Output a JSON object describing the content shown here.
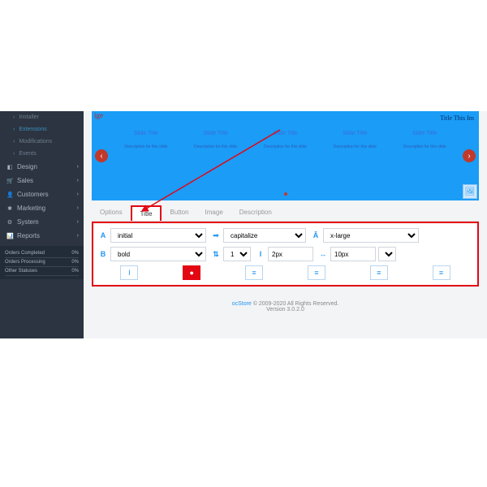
{
  "sidebar": {
    "sub": [
      {
        "label": "Installer",
        "active": false
      },
      {
        "label": "Extensions",
        "active": true
      },
      {
        "label": "Modifications",
        "active": false
      },
      {
        "label": "Events",
        "active": false
      }
    ],
    "items": [
      {
        "label": "Design",
        "icon": "◧"
      },
      {
        "label": "Sales",
        "icon": "🛒"
      },
      {
        "label": "Customers",
        "icon": "👤"
      },
      {
        "label": "Marketing",
        "icon": "✱"
      },
      {
        "label": "System",
        "icon": "⚙"
      },
      {
        "label": "Reports",
        "icon": "📊"
      }
    ],
    "stats": [
      {
        "label": "Orders Completed",
        "value": "0%"
      },
      {
        "label": "Orders Processing",
        "value": "0%"
      },
      {
        "label": "Other Statuses",
        "value": "0%"
      }
    ]
  },
  "banner": {
    "corner": "ige",
    "right": "Title This Im",
    "slides": [
      {
        "title": "Slide Title",
        "desc": "Description for this slide"
      },
      {
        "title": "Slide Title",
        "desc": "Description for this slide"
      },
      {
        "title": "Slide Title",
        "desc": "Description for this slide"
      },
      {
        "title": "Slide Title",
        "desc": "Description for this slide"
      },
      {
        "title": "Slide Title",
        "desc": "Description for this slide"
      }
    ]
  },
  "tabs": [
    {
      "label": "Options"
    },
    {
      "label": "Title"
    },
    {
      "label": "Button"
    },
    {
      "label": "Image"
    },
    {
      "label": "Description"
    }
  ],
  "active_tab": 1,
  "fields": {
    "font_family": "initial",
    "text_transform": "capitalize",
    "font_size": "x-large",
    "font_weight": "bold",
    "line_height_mode": "1",
    "line_height_val": "2px",
    "letter_spacing": "10px"
  },
  "buttons_row": [
    "I",
    "●",
    "≡",
    "≡",
    "≡",
    "≡"
  ],
  "footer": {
    "brand": "ocStore",
    "copyright": " © 2009-2020 All Rights Reserved.",
    "version": "Version 3.0.2.0"
  }
}
